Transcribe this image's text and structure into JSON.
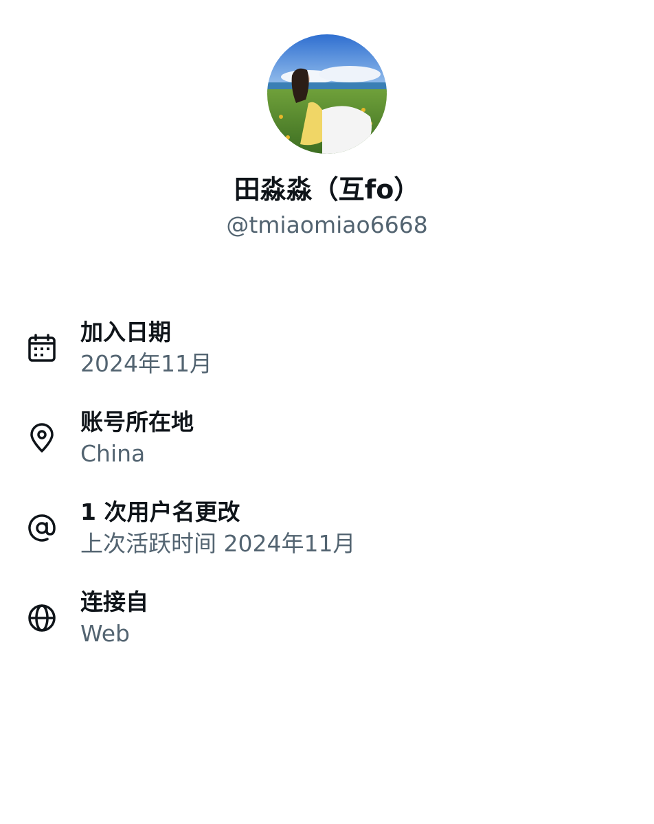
{
  "profile": {
    "display_name": "田淼淼（互fo）",
    "handle": "@tmiaomiao6668"
  },
  "info": [
    {
      "icon": "calendar-icon",
      "title": "加入日期",
      "value": "2024年11月"
    },
    {
      "icon": "location-pin-icon",
      "title": "账号所在地",
      "value": "China"
    },
    {
      "icon": "at-sign-icon",
      "title": "1 次用户名更改",
      "value": "上次活跃时间 2024年11月"
    },
    {
      "icon": "globe-icon",
      "title": "连接自",
      "value": "Web"
    }
  ],
  "colors": {
    "primary_text": "#0f1419",
    "secondary_text": "#536471",
    "background": "#ffffff"
  }
}
